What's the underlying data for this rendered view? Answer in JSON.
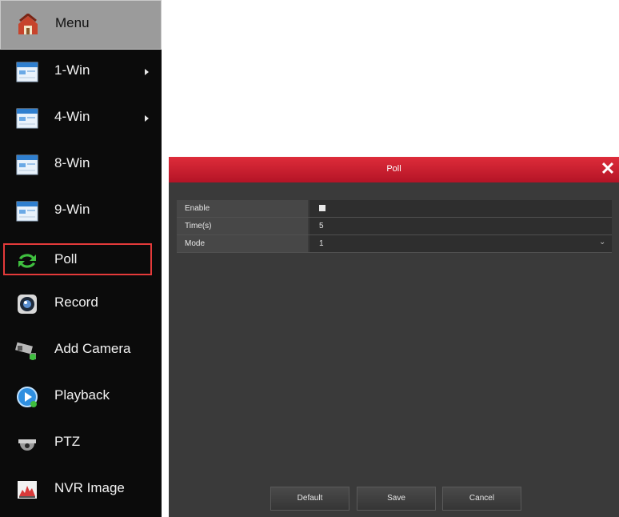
{
  "menu": {
    "header": {
      "label": "Menu",
      "icon": "house-icon"
    },
    "items": [
      {
        "label": "1-Win",
        "icon": "window-layout-icon",
        "submenu": true
      },
      {
        "label": "4-Win",
        "icon": "window-layout-icon",
        "submenu": true
      },
      {
        "label": "8-Win",
        "icon": "window-layout-icon",
        "submenu": false
      },
      {
        "label": "9-Win",
        "icon": "window-layout-icon",
        "submenu": false
      },
      {
        "label": "Poll",
        "icon": "poll-cycle-icon",
        "submenu": false,
        "active": true
      },
      {
        "label": "Record",
        "icon": "record-icon",
        "submenu": false
      },
      {
        "label": "Add Camera",
        "icon": "camera-icon",
        "submenu": false
      },
      {
        "label": "Playback",
        "icon": "playback-icon",
        "submenu": false
      },
      {
        "label": "PTZ",
        "icon": "dome-camera-icon",
        "submenu": false
      },
      {
        "label": "NVR Image",
        "icon": "image-chart-icon",
        "submenu": false
      }
    ],
    "highlight_color": "#e43a3a"
  },
  "dialog": {
    "title": "Poll",
    "close_icon": "close-icon",
    "fields": {
      "enable": {
        "label": "Enable",
        "checked": true
      },
      "time": {
        "label": "Time(s)",
        "value": "5"
      },
      "mode": {
        "label": "Mode",
        "value": "1"
      }
    },
    "buttons": {
      "default": "Default",
      "save": "Save",
      "cancel": "Cancel"
    },
    "titlebar_color": "#c81e30"
  }
}
